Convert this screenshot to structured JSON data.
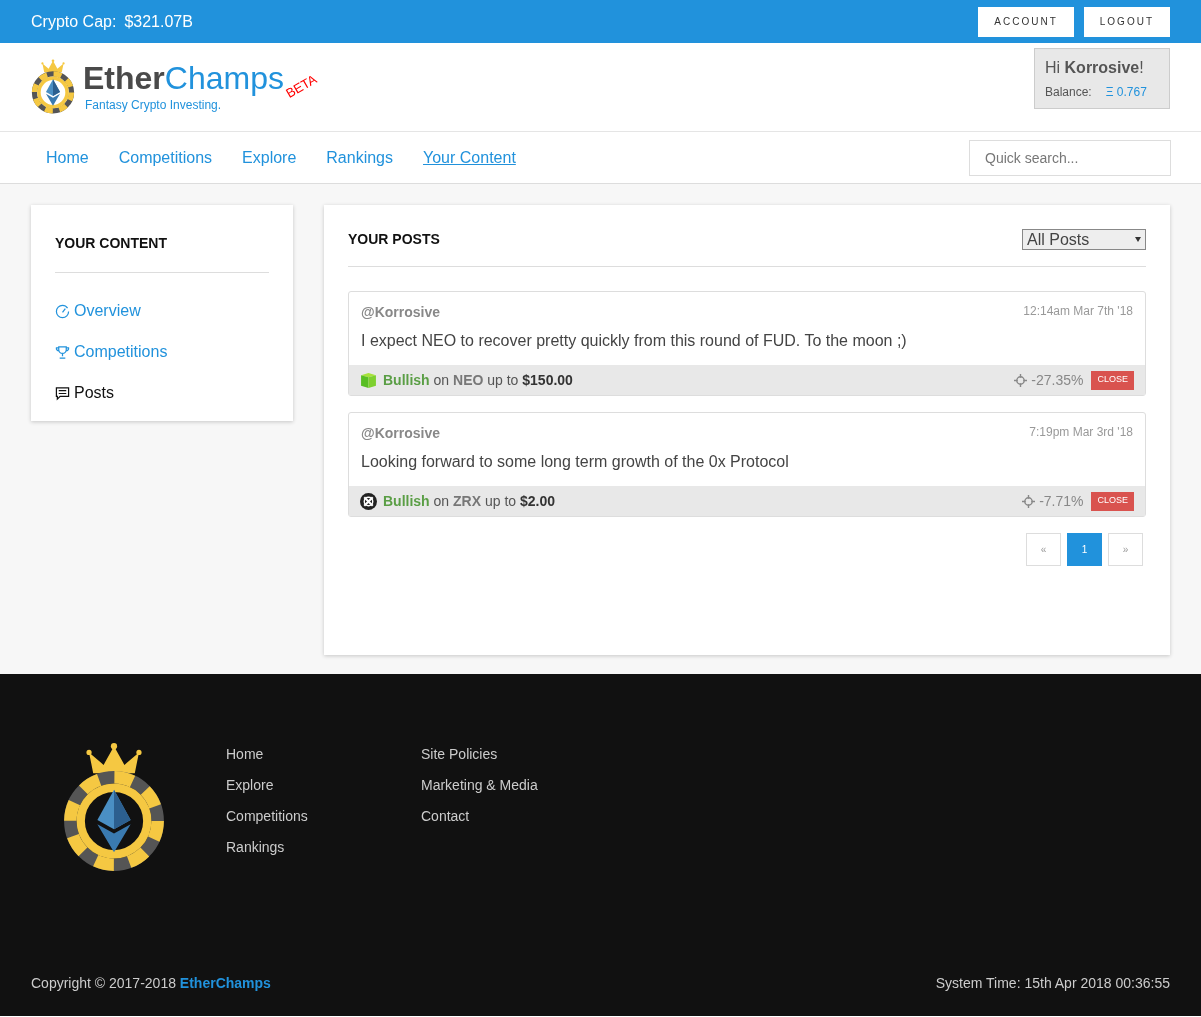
{
  "top_bar": {
    "cap_label": "Crypto Cap:",
    "cap_value": "$321.07B",
    "buttons": [
      "ACCOUNT",
      "LOGOUT"
    ]
  },
  "brand": {
    "name_dark": "Ether",
    "name_light": "Champs",
    "badge": "BETA",
    "tagline": "Fantasy Crypto Investing."
  },
  "user_box": {
    "greeting": "Hi **Korrosive**!",
    "balance_label": "Balance:",
    "balance_value": "Ξ 0.767"
  },
  "nav": [
    {
      "label": "Home",
      "selected": false
    },
    {
      "label": "Competitions",
      "selected": false
    },
    {
      "label": "Explore",
      "selected": false
    },
    {
      "label": "Rankings",
      "selected": false
    },
    {
      "label": "Your Content",
      "selected": true
    }
  ],
  "search": {
    "placeholder": "Quick search..."
  },
  "sidebar": {
    "title": "YOUR CONTENT",
    "items": [
      {
        "label": "Overview",
        "selected": false
      },
      {
        "label": "Competitions",
        "selected": false
      },
      {
        "label": "Posts",
        "selected": true
      }
    ]
  },
  "posts_panel": {
    "title": "YOUR POSTS",
    "filter": "All Posts",
    "posts": [
      {
        "author": "@Korrosive",
        "time": "12:14am Mar 7th '18",
        "body": "I expect NEO to recover pretty quickly from this round of FUD. To the moon ;)",
        "call": "**Bullish** on **NEO** up to **$150.00**",
        "change": "-27.35%",
        "close": "CLOSE"
      },
      {
        "author": "@Korrosive",
        "time": "7:19pm Mar 3rd '18",
        "body": "Looking forward to some long term growth of the 0x Protocol",
        "call": "**Bullish** on **ZRX** up to **$2.00**",
        "change": "-7.71%",
        "close": "CLOSE"
      }
    ],
    "pagination": {
      "prev": "«",
      "pages": [
        {
          "label": "1",
          "selected": true
        }
      ],
      "next": "»"
    }
  },
  "footer": {
    "columns": [
      [
        "Home",
        "Explore",
        "Competitions",
        "Rankings"
      ],
      [
        "Site Policies",
        "Marketing & Media",
        "Contact"
      ]
    ],
    "copyright": "Copyright © 2017-2018",
    "copyright_brand": "EtherChamps",
    "system_time": "System Time: 15th Apr 2018 00:36:55"
  }
}
